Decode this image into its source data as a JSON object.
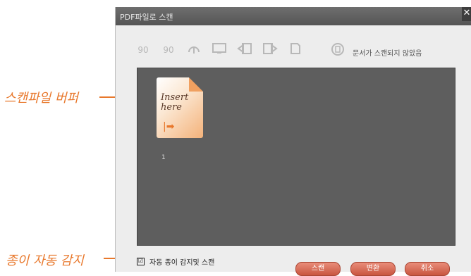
{
  "annotations": {
    "scan_buffer": "스캔파일 버퍼",
    "auto_detect": "종이 자동 감지"
  },
  "window": {
    "title": "PDF파일로 스캔",
    "close_glyph": "✕"
  },
  "toolbar": {
    "rotate_left_label": "90",
    "rotate_right_label": "90",
    "status_text": "문서가 스캔되지 않았음"
  },
  "buffer": {
    "documents": [
      {
        "thumb_text_line1": "Insert",
        "thumb_text_line2": "here",
        "label": "1"
      }
    ]
  },
  "footer": {
    "auto_detect_label": "자동 종이 감지및 스캔",
    "auto_detect_checked": "☑",
    "buttons": {
      "scan": "스캔",
      "convert": "변환",
      "cancel": "취소"
    }
  }
}
